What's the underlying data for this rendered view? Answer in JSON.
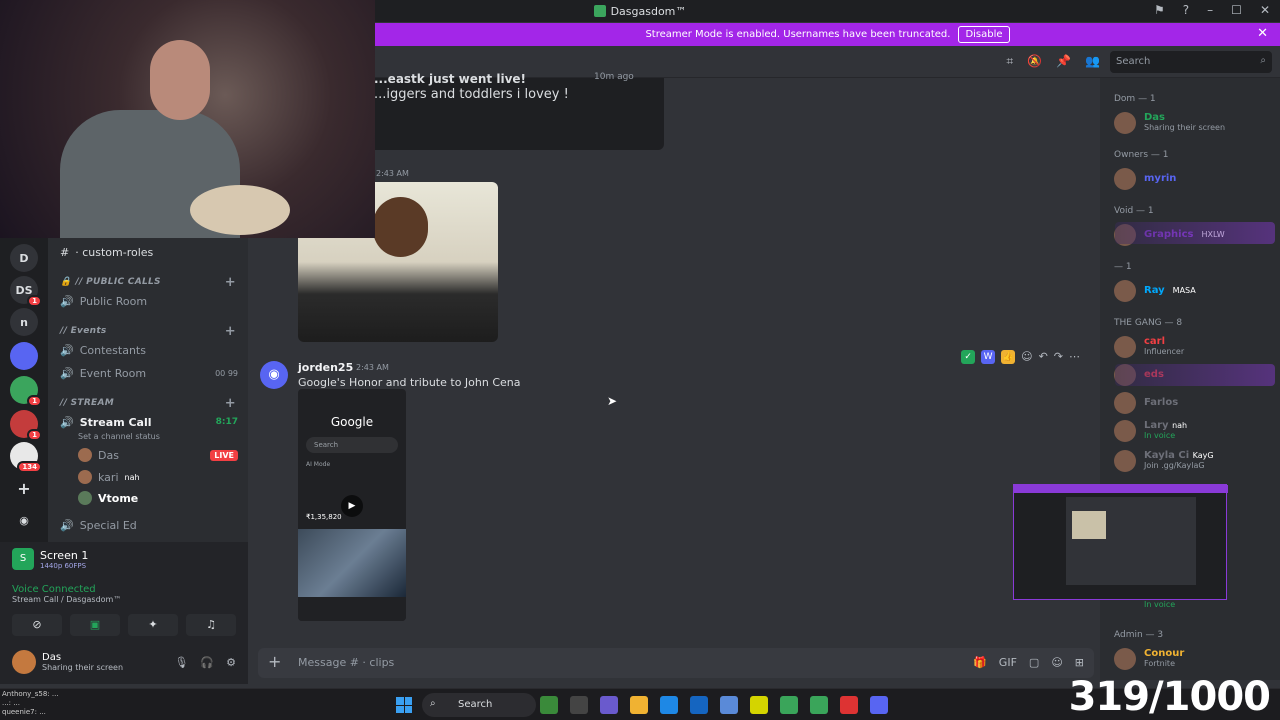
{
  "window": {
    "title": "Dasgasdom™"
  },
  "banner": {
    "text": "Streamer Mode is enabled. Usernames have been truncated.",
    "button": "Disable"
  },
  "search": {
    "placeholder": "Search"
  },
  "servers": [
    {
      "label": "D"
    },
    {
      "label": "DS",
      "badge": "1"
    },
    {
      "label": "n"
    },
    {
      "label": "",
      "badge": "1"
    },
    {
      "label": "",
      "badge": "1"
    },
    {
      "label": "",
      "badge": "134"
    }
  ],
  "channels": {
    "top": "· custom-roles",
    "public_calls_cat": "// PUBLIC CALLS",
    "public_room": "Public Room",
    "events_cat": "// Events",
    "contestants": "Contestants",
    "event_room": "Event Room",
    "event_room_counts": "00  99",
    "stream_cat": "// STREAM",
    "stream_call": "Stream Call",
    "stream_timer": "8:17",
    "channel_status": "Set a channel status",
    "voice_users": [
      {
        "name": "Das",
        "live": "LIVE"
      },
      {
        "name": "kari",
        "tag": "nah"
      },
      {
        "name": "Vtome"
      }
    ],
    "special_ed": "Special Ed"
  },
  "panel": {
    "screen_title": "Screen 1",
    "screen_sub": "1440p 60FPS",
    "voice_connected": "Voice Connected",
    "voice_location": "Stream Call / Dasgasdom™",
    "user_name": "Das",
    "user_status": "Sharing their screen"
  },
  "chat": {
    "embed_title": "...eastk just went live!",
    "embed_text": "...iggers and toddlers i lovey !",
    "embed_time": "10m ago",
    "msg1_time": "2:43 AM",
    "msg2": {
      "avatar": "◉",
      "user": "jorden25",
      "time": "2:43 AM",
      "text": "Google's Honor and tribute to John Cena"
    },
    "phone": {
      "brand": "Google",
      "search": "Search",
      "ai": "AI Mode",
      "price": "₹1,35,820"
    },
    "composer_placeholder": "Message # · clips"
  },
  "members": {
    "groups": [
      {
        "label": "Dom — 1"
      },
      {
        "label": "Owners — 1"
      },
      {
        "label": "Void — 1"
      },
      {
        "label": "— 1"
      },
      {
        "label": "THE GANG — 8"
      },
      {
        "label": "Admin — 3"
      }
    ],
    "list": [
      {
        "name": "Das",
        "status": "Sharing their screen",
        "color": "#23a55a"
      },
      {
        "name": "myrin",
        "status": "",
        "color": "#5865f2"
      },
      {
        "name": "Graphics",
        "status": "",
        "tag": "HXLW",
        "color": "#8a3ad8"
      },
      {
        "name": "Ray",
        "status": "",
        "tag": "MASA",
        "color": "#00a8fc"
      },
      {
        "name": "carl",
        "status": "Influencer",
        "color": "#f23f43"
      },
      {
        "name": "eds",
        "status": "",
        "color": "#f23f43"
      },
      {
        "name": "Farlos",
        "status": "",
        "color": "#4e5058"
      },
      {
        "name": "Lary",
        "status": "In voice",
        "tag": "nah",
        "color": "#4e5058"
      },
      {
        "name": "Kayla Ci",
        "status": "Join .gg/KaylaG",
        "tag": "KayG",
        "color": "#4e5058"
      },
      {
        "name": "",
        "status": "In voice",
        "color": "#4e5058"
      },
      {
        "name": "Conour",
        "status": "Fortnite",
        "color": "#f0b232"
      }
    ]
  },
  "taskbar": {
    "search": "Search"
  },
  "overlay": {
    "counter": "319/1000"
  },
  "chat_overlay": [
    "Anthony_s58: ...",
    "...: ...",
    "queenie7: ..."
  ]
}
